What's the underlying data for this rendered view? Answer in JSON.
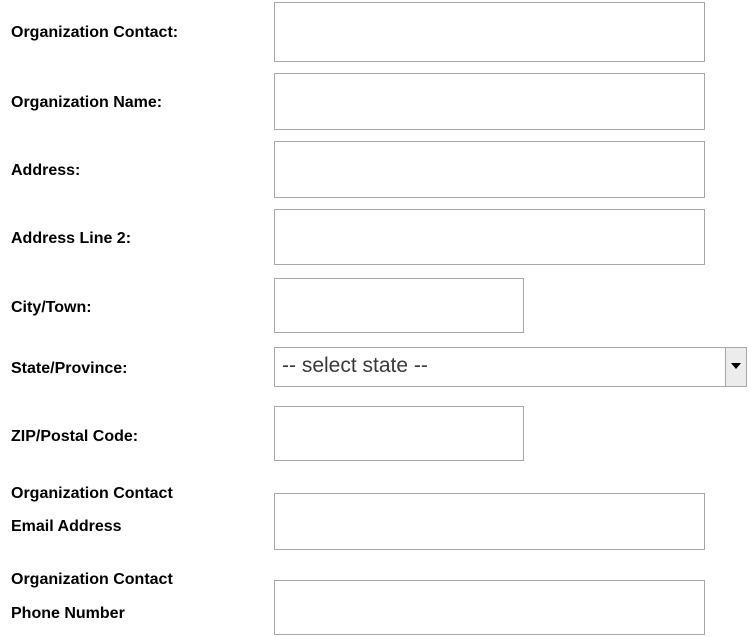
{
  "form": {
    "org_contact_label": "Organization  Contact:",
    "org_name_label": "Organization Name:",
    "address_label": "Address:",
    "address2_label": "Address Line 2:",
    "city_label": "City/Town:",
    "state_label": "State/Province:",
    "state_value": "-- select state --",
    "zip_label": "ZIP/Postal Code:",
    "email_label_line1": "Organization  Contact",
    "email_label_line2": "Email Address",
    "phone_label_line1": "Organization  Contact",
    "phone_label_line2": "Phone Number",
    "org_contact_value": "",
    "org_name_value": "",
    "address_value": "",
    "address2_value": "",
    "city_value": "",
    "zip_value": "",
    "email_value": "",
    "phone_value": "",
    "dropdown_icon": "chevron-down-icon"
  }
}
